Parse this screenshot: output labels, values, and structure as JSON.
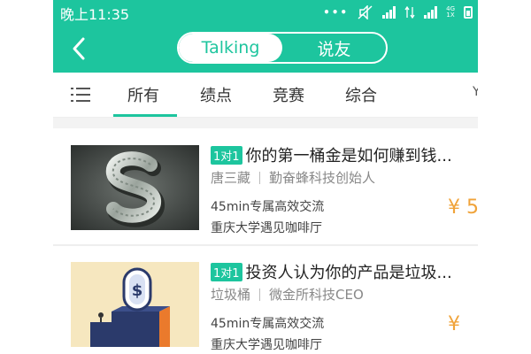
{
  "status_bar": {
    "time": "晚上11:35",
    "dots": "•••",
    "network_label_top": "4G",
    "network_label_bottom": "1X"
  },
  "nav": {
    "tabs": [
      {
        "label": "Talking",
        "active": true
      },
      {
        "label": "说友",
        "active": false
      }
    ]
  },
  "categories": {
    "items": [
      "所有",
      "绩点",
      "竞赛",
      "综合"
    ],
    "active_index": 0,
    "more": "Y"
  },
  "cards": [
    {
      "badge": "1对1",
      "title": "你的第一桶金是如何赚到钱...",
      "person": "唐三藏",
      "role": "勤奋蜂科技创始人",
      "duration": "45min专属高效交流",
      "venue": "重庆大学遇见咖啡厅",
      "price": "¥ 5",
      "image": "silver-dollar-sign-icon"
    },
    {
      "badge": "1对1",
      "title": "投资人认为你的产品是垃圾...",
      "person": "垃圾桶",
      "role": "微金所科技CEO",
      "duration": "45min专属高效交流",
      "venue": "重庆大学遇见咖啡厅",
      "price": "¥",
      "image": "dollar-coin-slot-illustration"
    }
  ],
  "colors": {
    "accent": "#1dc59e",
    "price": "#f0a33a"
  }
}
